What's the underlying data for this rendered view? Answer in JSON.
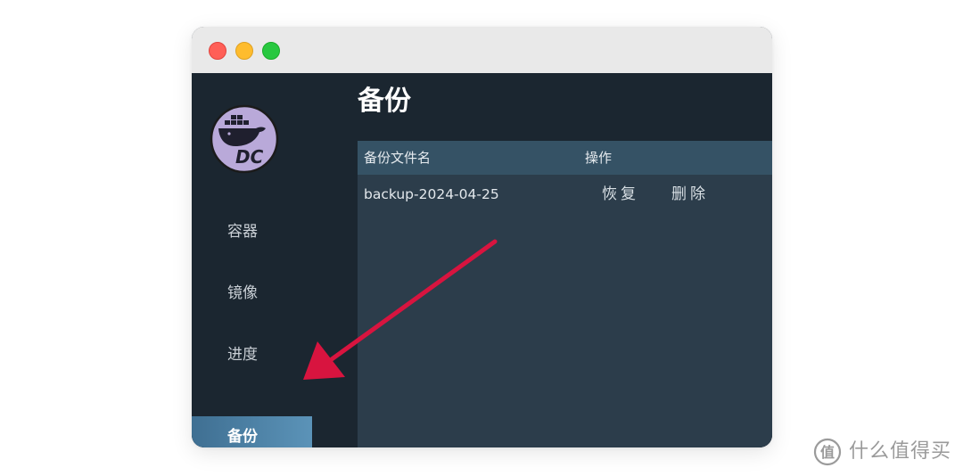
{
  "sidebar": {
    "logo_text": "DC",
    "items": [
      {
        "label": "容器",
        "active": false
      },
      {
        "label": "镜像",
        "active": false
      },
      {
        "label": "进度",
        "active": false
      },
      {
        "label": "备份",
        "active": true
      }
    ]
  },
  "main": {
    "title": "备份",
    "table": {
      "columns": [
        "备份文件名",
        "操作"
      ],
      "rows": [
        {
          "filename": "backup-2024-04-25",
          "actions": [
            "恢复",
            "删除"
          ]
        }
      ]
    }
  },
  "watermark": {
    "text": "什么值得买"
  },
  "colors": {
    "accent": "#5b93b8",
    "background": "#1b2630",
    "panel": "#2c3d4b",
    "table_header": "#355265",
    "arrow": "#d8143f"
  }
}
